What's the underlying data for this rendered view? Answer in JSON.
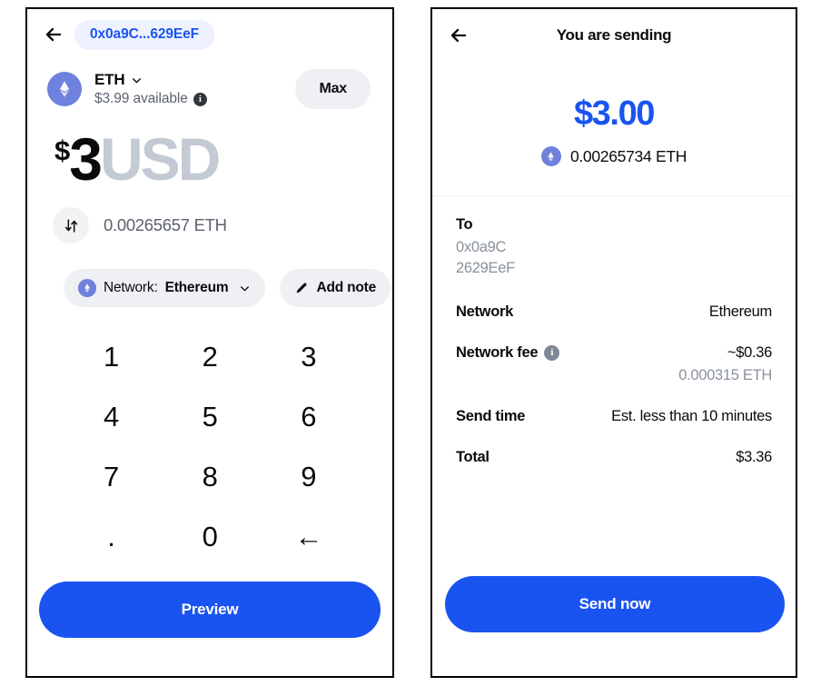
{
  "colors": {
    "accent_blue": "#1a54f0",
    "pill_bg": "#eef2fe",
    "chip_bg": "#eef0f3",
    "eth_badge": "#6f81dd",
    "muted_text": "#5b616e",
    "faded_unit": "#c4cad4",
    "address_gray": "#8a919e"
  },
  "send_screen": {
    "back_icon": "back-arrow-icon",
    "address_pill": "0x0a9C...629EeF",
    "asset": {
      "token_icon": "ethereum-token-icon",
      "symbol": "ETH",
      "chevron_icon": "chevron-down-icon",
      "available": "$3.99 available",
      "info_icon": "info-icon"
    },
    "max_label": "Max",
    "amount": {
      "currency_symbol": "$",
      "value": "3",
      "unit": "USD"
    },
    "crypto_equivalent": {
      "swap_icon": "swap-vertical-icon",
      "text": "0.00265657 ETH"
    },
    "network_chip": {
      "token_icon": "ethereum-token-icon",
      "prefix": "Network:",
      "value": "Ethereum",
      "chevron_icon": "chevron-down-icon"
    },
    "note_chip": {
      "pencil_icon": "pencil-icon",
      "label": "Add note"
    },
    "keypad": [
      {
        "key": "1",
        "name": "key-1"
      },
      {
        "key": "2",
        "name": "key-2"
      },
      {
        "key": "3",
        "name": "key-3"
      },
      {
        "key": "4",
        "name": "key-4"
      },
      {
        "key": "5",
        "name": "key-5"
      },
      {
        "key": "6",
        "name": "key-6"
      },
      {
        "key": "7",
        "name": "key-7"
      },
      {
        "key": "8",
        "name": "key-8"
      },
      {
        "key": "9",
        "name": "key-9"
      },
      {
        "key": ".",
        "name": "key-decimal"
      },
      {
        "key": "0",
        "name": "key-0"
      },
      {
        "key": "←",
        "name": "key-backspace"
      }
    ],
    "cta_label": "Preview"
  },
  "confirm_screen": {
    "back_icon": "back-arrow-icon",
    "title": "You are sending",
    "amount_usd": "$3.00",
    "amount_crypto": "0.00265734 ETH",
    "token_icon": "ethereum-token-icon",
    "rows": [
      {
        "label": "To",
        "address_line1": "0x0a9C",
        "address_line2": "2629EeF"
      },
      {
        "label": "Network",
        "value": "Ethereum"
      },
      {
        "label": "Network fee",
        "info_icon": "info-icon",
        "value": "~$0.36",
        "sub_value": "0.000315 ETH"
      },
      {
        "label": "Send time",
        "value": "Est. less than 10 minutes"
      },
      {
        "label": "Total",
        "value": "$3.36"
      }
    ],
    "cta_label": "Send now"
  }
}
